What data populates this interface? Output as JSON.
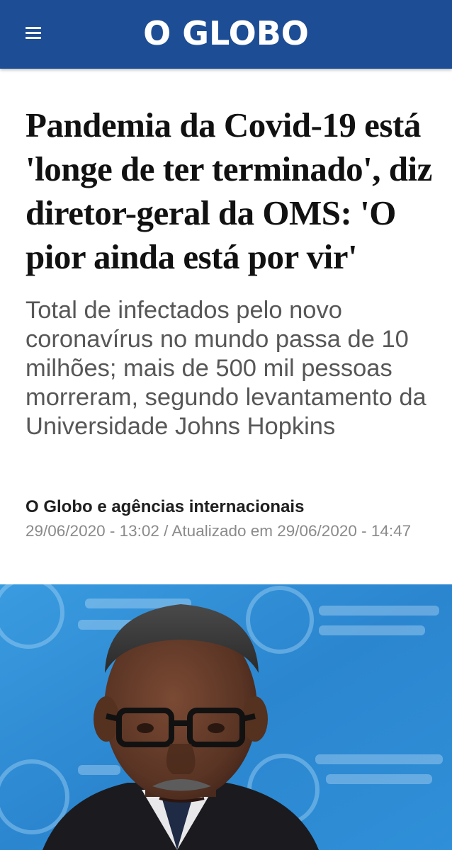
{
  "header": {
    "logo_text": "O GLOBO",
    "menu_icon": "hamburger-menu-icon",
    "background_color": "#1d4d94"
  },
  "article": {
    "headline": "Pandemia da Covid-19 está 'longe de ter terminado', diz diretor-geral da OMS: 'O pior ainda está por vir'",
    "subtitle": "Total de infectados pelo novo coronavírus no mundo passa de 10 milhões; mais de 500 mil pessoas morreram, segundo levantamento da Universidade Johns Hopkins",
    "author": "O Globo e agências internacionais",
    "dateline": "29/06/2020 - 13:02 / Atualizado em 29/06/2020 - 14:47"
  },
  "photo": {
    "subject": "lead-photo",
    "background_color": "#2e8fd6"
  }
}
